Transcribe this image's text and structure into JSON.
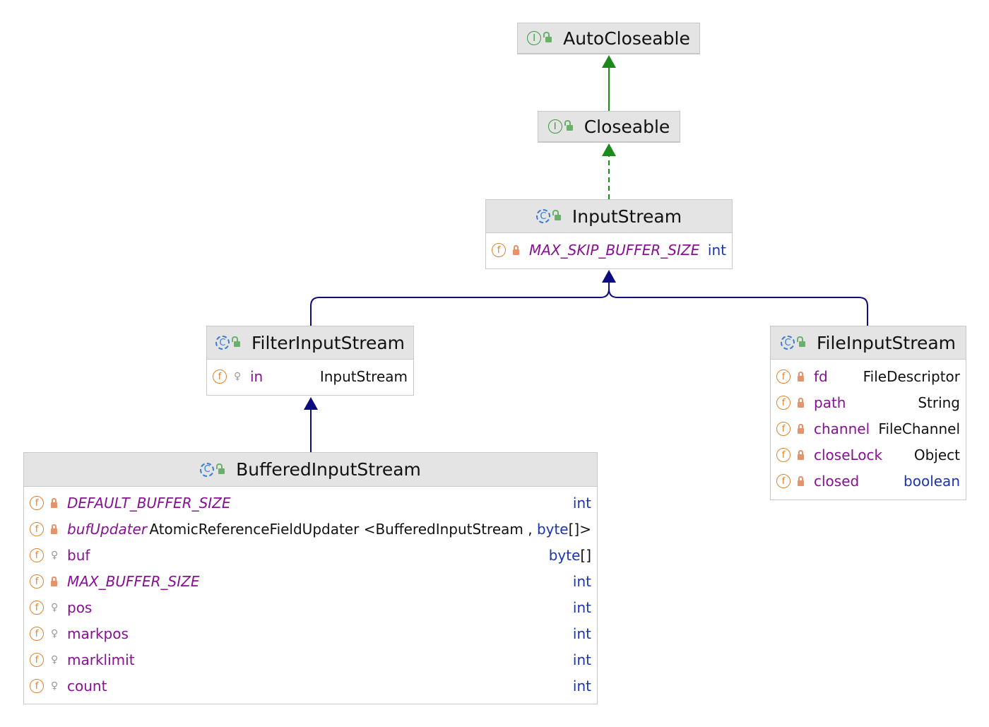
{
  "colors": {
    "implements": "#1a8a1a",
    "extends": "#0c0c80",
    "field_name": "#871094",
    "keyword": "#1a35b0"
  },
  "nodes": {
    "autocloseable": {
      "kind": "interface",
      "title": "AutoCloseable",
      "fields": []
    },
    "closeable": {
      "kind": "interface",
      "title": "Closeable",
      "fields": []
    },
    "inputstream": {
      "kind": "abstract-class",
      "title": "InputStream",
      "fields": [
        {
          "name": "MAX_SKIP_BUFFER_SIZE",
          "static": true,
          "visibility": "private",
          "type": [
            {
              "t": "int",
              "kw": true
            }
          ]
        }
      ]
    },
    "filterinputstream": {
      "kind": "class",
      "title": "FilterInputStream",
      "fields": [
        {
          "name": "in",
          "static": false,
          "visibility": "protected",
          "type": [
            {
              "t": "InputStream",
              "kw": false
            }
          ]
        }
      ]
    },
    "fileinputstream": {
      "kind": "class",
      "title": "FileInputStream",
      "fields": [
        {
          "name": "fd",
          "static": false,
          "visibility": "private",
          "type": [
            {
              "t": "FileDescriptor",
              "kw": false
            }
          ]
        },
        {
          "name": "path",
          "static": false,
          "visibility": "private",
          "type": [
            {
              "t": "String",
              "kw": false
            }
          ]
        },
        {
          "name": "channel",
          "static": false,
          "visibility": "private",
          "type": [
            {
              "t": "FileChannel",
              "kw": false
            }
          ]
        },
        {
          "name": "closeLock",
          "static": false,
          "visibility": "private",
          "type": [
            {
              "t": "Object",
              "kw": false
            }
          ]
        },
        {
          "name": "closed",
          "static": false,
          "visibility": "private",
          "type": [
            {
              "t": "boolean",
              "kw": true
            }
          ]
        }
      ]
    },
    "bufferedinputstream": {
      "kind": "class",
      "title": "BufferedInputStream",
      "fields": [
        {
          "name": "DEFAULT_BUFFER_SIZE",
          "static": true,
          "visibility": "private",
          "type": [
            {
              "t": "int",
              "kw": true
            }
          ]
        },
        {
          "name": "bufUpdater",
          "static": true,
          "visibility": "private",
          "type": [
            {
              "t": "AtomicReferenceFieldUpdater <BufferedInputStream , ",
              "kw": false
            },
            {
              "t": "byte",
              "kw": true
            },
            {
              "t": "[]>",
              "kw": false
            }
          ]
        },
        {
          "name": "buf",
          "static": false,
          "visibility": "protected",
          "type": [
            {
              "t": "byte",
              "kw": true
            },
            {
              "t": "[]",
              "kw": false
            }
          ]
        },
        {
          "name": "MAX_BUFFER_SIZE",
          "static": true,
          "visibility": "private",
          "type": [
            {
              "t": "int",
              "kw": true
            }
          ]
        },
        {
          "name": "pos",
          "static": false,
          "visibility": "protected",
          "type": [
            {
              "t": "int",
              "kw": true
            }
          ]
        },
        {
          "name": "markpos",
          "static": false,
          "visibility": "protected",
          "type": [
            {
              "t": "int",
              "kw": true
            }
          ]
        },
        {
          "name": "marklimit",
          "static": false,
          "visibility": "protected",
          "type": [
            {
              "t": "int",
              "kw": true
            }
          ]
        },
        {
          "name": "count",
          "static": false,
          "visibility": "protected",
          "type": [
            {
              "t": "int",
              "kw": true
            }
          ]
        }
      ]
    }
  },
  "edges": [
    {
      "from": "Closeable",
      "to": "AutoCloseable",
      "type": "extends-interface"
    },
    {
      "from": "InputStream",
      "to": "Closeable",
      "type": "implements"
    },
    {
      "from": "FilterInputStream",
      "to": "InputStream",
      "type": "extends"
    },
    {
      "from": "FileInputStream",
      "to": "InputStream",
      "type": "extends"
    },
    {
      "from": "BufferedInputStream",
      "to": "FilterInputStream",
      "type": "extends"
    }
  ]
}
